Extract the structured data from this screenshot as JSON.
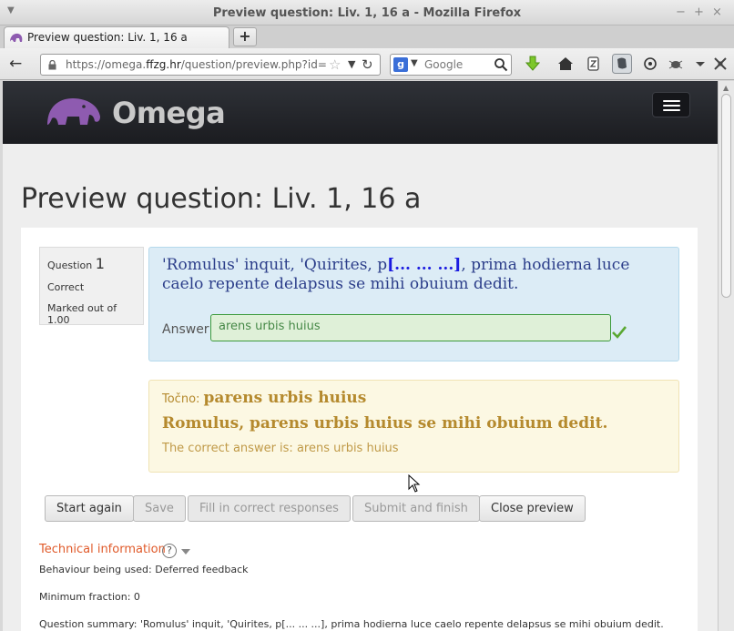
{
  "window": {
    "title": "Preview question: Liv. 1, 16 a - Mozilla Firefox",
    "menu_glyph": "▼",
    "controls": [
      "−",
      "+",
      "×"
    ]
  },
  "tab": {
    "label": "Preview question: Liv. 1, 16 a",
    "new_tab_glyph": "+"
  },
  "nav": {
    "back_glyph": "←",
    "url_prefix": "https://omega.",
    "url_host": "ffzg.hr",
    "url_rest": "/question/preview.php?id=",
    "star_glyph": "☆",
    "drop_glyph": "▼",
    "reload_glyph": "↻",
    "search_engine_letter": "g",
    "search_drop_glyph": "▼",
    "search_placeholder": "Google"
  },
  "site": {
    "brand": "Omega"
  },
  "page": {
    "title": "Preview question: Liv. 1, 16 a"
  },
  "question_info": {
    "question_word": "Question",
    "number": "1",
    "state": "Correct",
    "grade": "Marked out of 1.00"
  },
  "question": {
    "text_before": "'Romulus' inquit, 'Quirites, p",
    "blank": "[... ... ...]",
    "text_after": ", prima hodierna luce caelo repente delapsus se mihi obuium dedit.",
    "answer_label": "Answer:",
    "answer_value": "arens urbis huius"
  },
  "feedback": {
    "label": "Točno:",
    "answer": "parens urbis huius",
    "sentence": "Romulus, parens urbis huius se mihi obuium dedit.",
    "right_answer": "The correct answer is: arens urbis huius"
  },
  "buttons": {
    "start_again": "Start again",
    "save": "Save",
    "fill": "Fill in correct responses",
    "submit": "Submit and finish",
    "close": "Close preview"
  },
  "technical": {
    "heading": "Technical information",
    "help_glyph": "?",
    "behaviour": "Behaviour being used: Deferred feedback",
    "min_fraction": "Minimum fraction: 0",
    "summary": "Question summary: 'Romulus' inquit, 'Quirites, p[... ... ...], prima hodierna luce caelo repente delapsus se mihi obuium dedit."
  },
  "colors": {
    "brand_bar": "#1f2024",
    "question_bg": "#dcecf6",
    "feedback_bg": "#fcf8e3",
    "correct_green": "#468847",
    "tech_heading": "#e05a2a"
  }
}
